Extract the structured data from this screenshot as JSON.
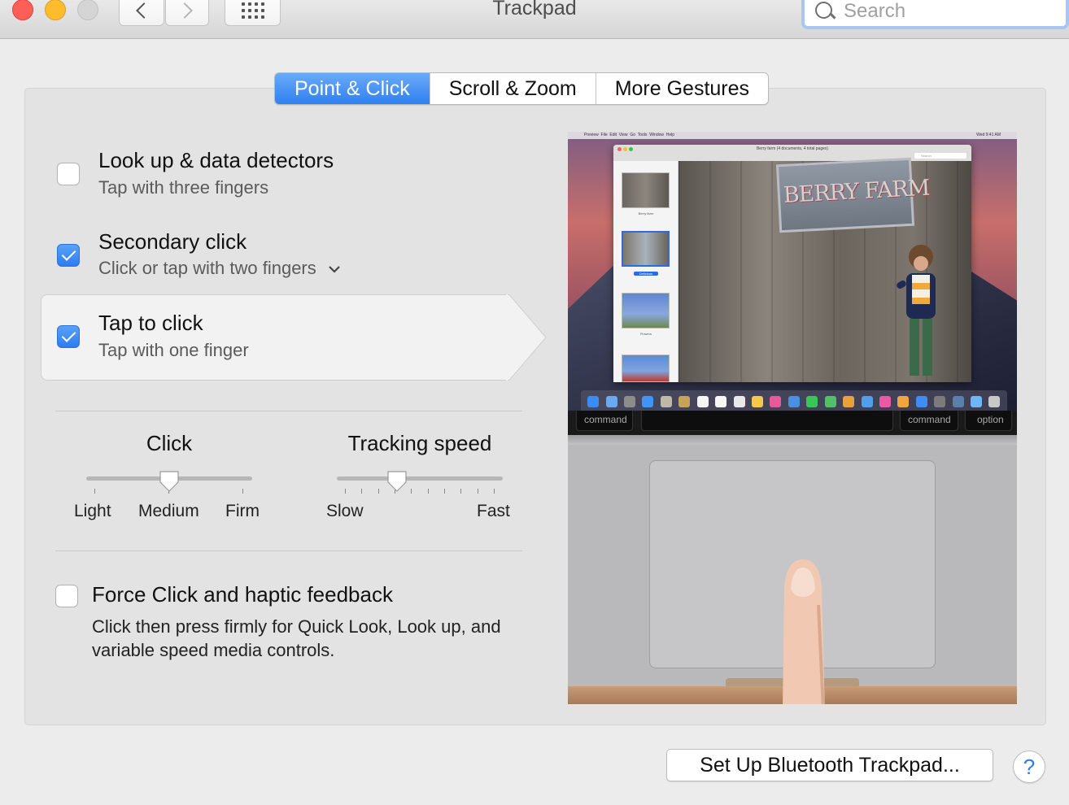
{
  "window": {
    "title": "Trackpad",
    "search_placeholder": "Search"
  },
  "tabs": [
    {
      "label": "Point & Click",
      "active": true
    },
    {
      "label": "Scroll & Zoom",
      "active": false
    },
    {
      "label": "More Gestures",
      "active": false
    }
  ],
  "options": {
    "lookup": {
      "title": "Look up & data detectors",
      "subtitle": "Tap with three fingers",
      "checked": false
    },
    "secondary": {
      "title": "Secondary click",
      "subtitle": "Click or tap with two fingers",
      "checked": true
    },
    "tap": {
      "title": "Tap to click",
      "subtitle": "Tap with one finger",
      "checked": true
    }
  },
  "click_slider": {
    "title": "Click",
    "labels": [
      "Light",
      "Medium",
      "Firm"
    ],
    "value": "Medium"
  },
  "tracking_slider": {
    "title": "Tracking speed",
    "min_label": "Slow",
    "max_label": "Fast",
    "tick_count": 10,
    "value_fraction": 0.35
  },
  "force_click": {
    "title": "Force Click and haptic feedback",
    "description": "Click then press firmly for Quick Look, Look up, and variable speed media controls.",
    "checked": false
  },
  "preview": {
    "sign_text": "BERRY FARM",
    "keys": {
      "command_left": "command",
      "command_right": "command",
      "option": "option"
    }
  },
  "buttons": {
    "bluetooth": "Set Up Bluetooth Trackpad...",
    "help": "?"
  },
  "colors": {
    "accent": "#2f80f1",
    "close": "#fc5f57",
    "minimize": "#fdbc2e",
    "zoom": "#d5d5d5"
  }
}
